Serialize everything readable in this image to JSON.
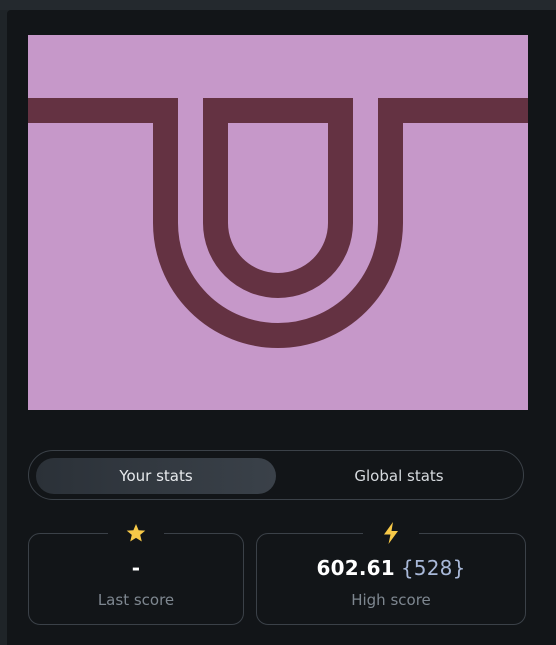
{
  "colors": {
    "puzzle_background": "#c698c9",
    "puzzle_line": "#643242",
    "accent_star": "#f7c948",
    "accent_bolt": "#f7c948"
  },
  "tabs": {
    "your_stats": "Your stats",
    "global_stats": "Global stats",
    "active": "your_stats"
  },
  "stats": {
    "last": {
      "icon": "star-icon",
      "value": "-",
      "label": "Last score"
    },
    "high": {
      "icon": "lightning-icon",
      "value": "602.61",
      "extra": "{528}",
      "label": "High score"
    }
  }
}
